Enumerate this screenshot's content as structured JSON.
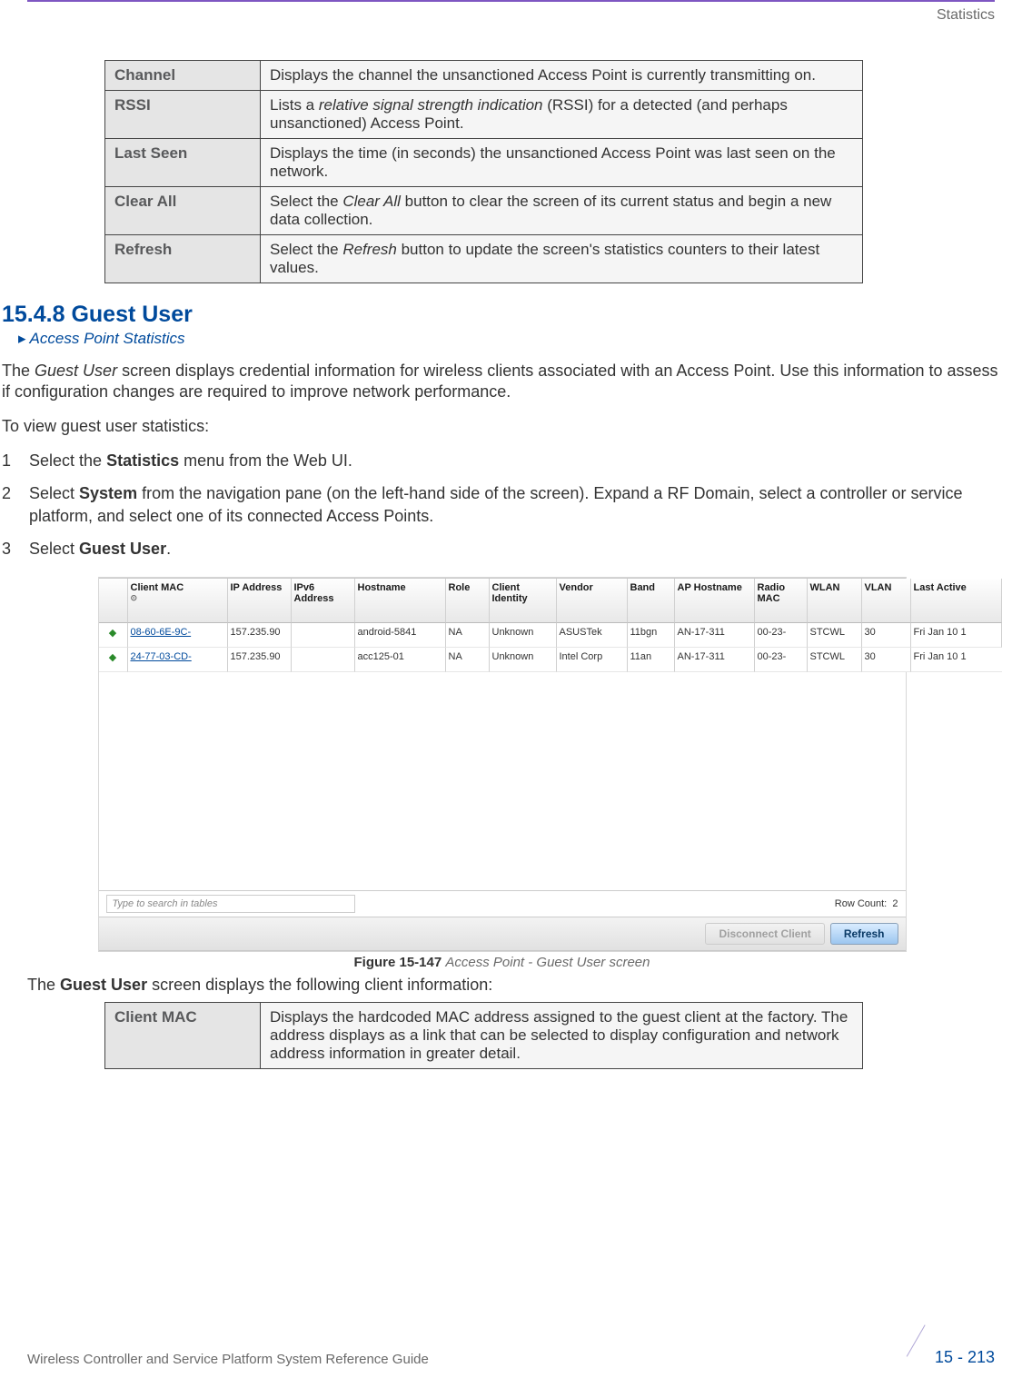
{
  "header": {
    "section": "Statistics"
  },
  "table1": {
    "rows": [
      {
        "label": "Channel",
        "desc_plain": "Displays the channel the unsanctioned Access Point is currently transmitting on."
      },
      {
        "label": "RSSI",
        "desc_pre": "Lists a ",
        "desc_ital": "relative signal strength indication",
        "desc_post": " (RSSI) for a detected (and perhaps unsanctioned) Access Point."
      },
      {
        "label": "Last Seen",
        "desc_plain": "Displays the time (in seconds) the unsanctioned Access Point was last seen on the network."
      },
      {
        "label": "Clear All",
        "desc_pre": "Select the ",
        "desc_ital": "Clear All",
        "desc_post": " button to clear the screen of its current status and begin a new data collection."
      },
      {
        "label": "Refresh",
        "desc_pre": "Select the ",
        "desc_ital": "Refresh",
        "desc_post": " button to update the screen's statistics counters to their latest values."
      }
    ]
  },
  "section": {
    "number_title": "15.4.8 Guest User",
    "breadcrumb": "Access Point Statistics",
    "intro_pre": "The ",
    "intro_ital": "Guest User",
    "intro_post": " screen displays credential information for wireless clients associated with an Access Point. Use this information to assess if configuration changes are required to improve network performance.",
    "intro2": "To view guest user statistics:",
    "steps": [
      {
        "pre": "Select the ",
        "bold": "Statistics",
        "post": " menu from the Web UI."
      },
      {
        "pre": "Select ",
        "bold": "System",
        "post": " from the navigation pane (on the left-hand side of the screen). Expand a RF Domain, select a controller or service platform, and select one of its connected Access Points."
      },
      {
        "pre": "Select ",
        "bold": "Guest User",
        "post": "."
      }
    ]
  },
  "screenshot": {
    "columns": [
      "",
      "Client MAC",
      "IP Address",
      "IPv6 Address",
      "Hostname",
      "Role",
      "Client Identity",
      "Vendor",
      "Band",
      "AP Hostname",
      "Radio MAC",
      "WLAN",
      "VLAN",
      "Last Active"
    ],
    "sort_col_index": 1,
    "rows": [
      {
        "icon": "◆",
        "mac": "08-60-6E-9C-",
        "ip": "157.235.90",
        "ipv6": "",
        "host": "android-5841",
        "role": "NA",
        "cid": "Unknown",
        "vendor": "ASUSTek",
        "band": "11bgn",
        "aphost": "AN-17-311",
        "radio": "00-23-",
        "wlan": "STCWL",
        "vlan": "30",
        "last": "Fri Jan 10 1"
      },
      {
        "icon": "◆",
        "mac": "24-77-03-CD-",
        "ip": "157.235.90",
        "ipv6": "",
        "host": "acc125-01",
        "role": "NA",
        "cid": "Unknown",
        "vendor": "Intel Corp",
        "band": "11an",
        "aphost": "AN-17-311",
        "radio": "00-23-",
        "wlan": "STCWL",
        "vlan": "30",
        "last": "Fri Jan 10 1"
      }
    ],
    "search_placeholder": "Type to search in tables",
    "row_count_label": "Row Count:",
    "row_count_value": "2",
    "btn_disconnect": "Disconnect Client",
    "btn_refresh": "Refresh"
  },
  "figure": {
    "num": "Figure 15-147",
    "title": "Access Point - Guest User screen"
  },
  "below_fig_pre": "The ",
  "below_fig_bold": "Guest User",
  "below_fig_post": " screen displays the following client information:",
  "table2": {
    "rows": [
      {
        "label": "Client MAC",
        "desc_plain": "Displays the hardcoded MAC address assigned to the guest client at the factory. The address displays as a link that can be selected to display configuration and network address information in greater detail."
      }
    ]
  },
  "footer": {
    "left": "Wireless Controller and Service Platform System Reference Guide",
    "right": "15 - 213"
  }
}
